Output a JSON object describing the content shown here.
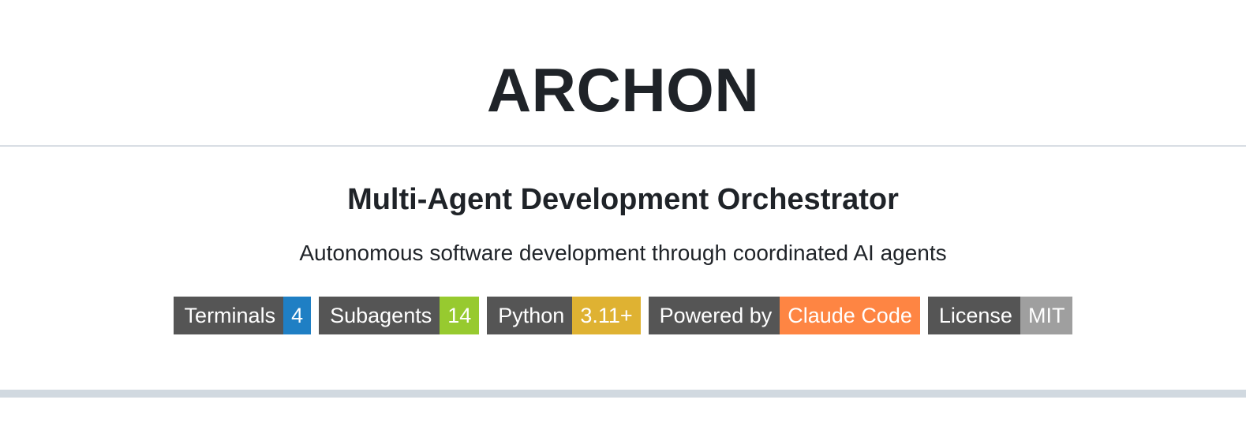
{
  "header": {
    "title": "ARCHON"
  },
  "main": {
    "subtitle": "Multi-Agent Development Orchestrator",
    "tagline": "Autonomous software development through coordinated AI agents"
  },
  "badges": [
    {
      "label": "Terminals",
      "value": "4",
      "color": "#1f7fc4"
    },
    {
      "label": "Subagents",
      "value": "14",
      "color": "#97ca2f"
    },
    {
      "label": "Python",
      "value": "3.11+",
      "color": "#dfb232"
    },
    {
      "label": "Powered by",
      "value": "Claude Code",
      "color": "#fe8543"
    },
    {
      "label": "License",
      "value": "MIT",
      "color": "#9f9f9f"
    }
  ],
  "colors": {
    "badge_label_bg": "#555555",
    "text": "#1f2328",
    "rule": "#d8dee4"
  }
}
